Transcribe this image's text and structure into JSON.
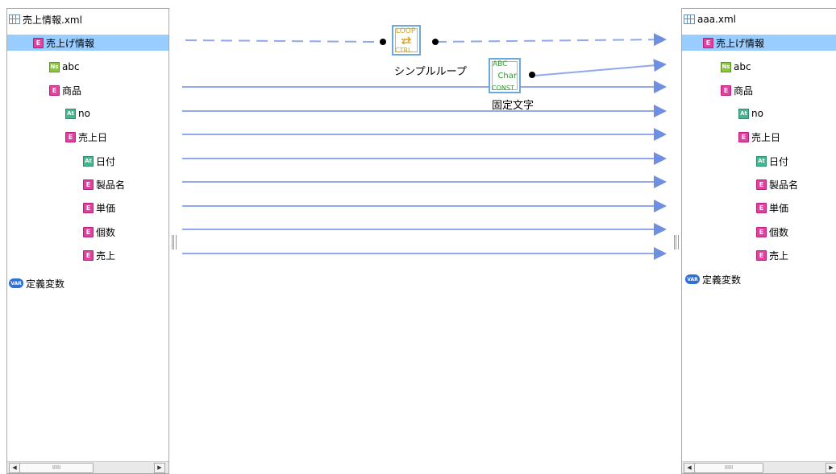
{
  "left_tree": {
    "file": "売上情報.xml",
    "nodes": [
      {
        "icon": "E",
        "label": "売上げ情報",
        "selected": true
      },
      {
        "icon": "Ns",
        "label": "abc"
      },
      {
        "icon": "E",
        "label": "商品"
      },
      {
        "icon": "At",
        "label": "no"
      },
      {
        "icon": "E",
        "label": "売上日"
      },
      {
        "icon": "At",
        "label": "日付"
      },
      {
        "icon": "E",
        "label": "製品名"
      },
      {
        "icon": "E",
        "label": "単価"
      },
      {
        "icon": "E",
        "label": "個数"
      },
      {
        "icon": "E",
        "label": "売上"
      }
    ],
    "variables": "定義変数"
  },
  "right_tree": {
    "file": "aaa.xml",
    "nodes": [
      {
        "icon": "E",
        "label": "売上げ情報",
        "selected": true
      },
      {
        "icon": "Ns",
        "label": "abc"
      },
      {
        "icon": "E",
        "label": "商品"
      },
      {
        "icon": "At",
        "label": "no"
      },
      {
        "icon": "E",
        "label": "売上日"
      },
      {
        "icon": "At",
        "label": "日付"
      },
      {
        "icon": "E",
        "label": "製品名"
      },
      {
        "icon": "E",
        "label": "単価"
      },
      {
        "icon": "E",
        "label": "個数"
      },
      {
        "icon": "E",
        "label": "売上"
      }
    ],
    "variables": "定義変数"
  },
  "icon_badges": {
    "E": "E",
    "Ns": "Ns",
    "At": "At",
    "var": "VAR"
  },
  "functions": {
    "loop": {
      "top": "LOOP",
      "bottom": "CTRL",
      "label": "シンプルループ"
    },
    "const": {
      "top": "ABC",
      "middle": "Char",
      "bottom": "CONST",
      "label": "固定文字"
    }
  },
  "scrollbar": {
    "left_arrow": "◀",
    "right_arrow": "▶",
    "thumb_grip": "IIIII"
  },
  "colors": {
    "selection": "#99ccff",
    "link": "#8fa9ea",
    "element_icon": "#e33fa0",
    "namespace_icon": "#8cc63e",
    "attribute_icon": "#47b58d",
    "function_border": "#6aa8de",
    "loop_text": "#d4a017",
    "const_text": "#2a9d2a"
  }
}
